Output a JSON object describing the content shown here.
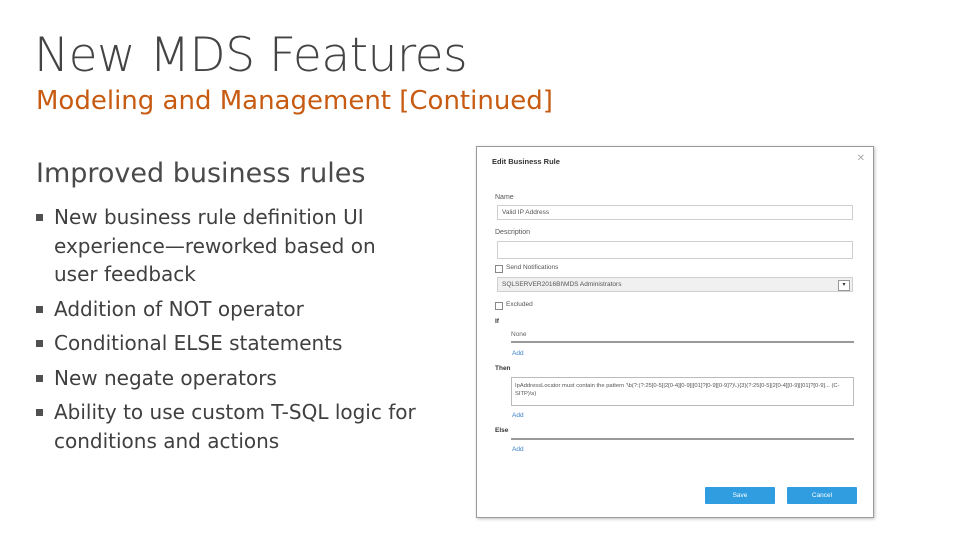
{
  "slide": {
    "title": "New MDS Features",
    "subtitle": "Modeling and Management [Continued]",
    "section_heading": "Improved business rules",
    "bullets": [
      "New business rule definition UI experience—reworked based on user feedback",
      "Addition of NOT operator",
      "Conditional ELSE statements",
      "New negate operators",
      "Ability to use custom T-SQL logic for conditions and actions"
    ]
  },
  "dialog": {
    "title": "Edit Business Rule",
    "close_icon": "close-icon",
    "name_label": "Name",
    "name_value": "Valid IP Address",
    "description_label": "Description",
    "description_value": "",
    "send_notifications_label": "Send Notifications",
    "notify_select_value": "SQLSERVER2016BI\\MDS Administrators",
    "excluded_label": "Excluded",
    "if_label": "If",
    "if_condition": "None",
    "then_label": "Then",
    "then_action": "IpAddressLocator must contain the pattern '\\b(?:(?:25[0-5]|2[0-4][0-9]|[01]?[0-9][0-9]?)\\.){3}(?:25[0-5]|2[0-4][0-9]|[01]?[0-9]... (C-SITP)\\s)",
    "else_label": "Else",
    "add_label": "Add",
    "save_label": "Save",
    "cancel_label": "Cancel"
  },
  "colors": {
    "subtitle": "#c75b12",
    "button": "#2f9de0",
    "link": "#3a7fc7"
  }
}
